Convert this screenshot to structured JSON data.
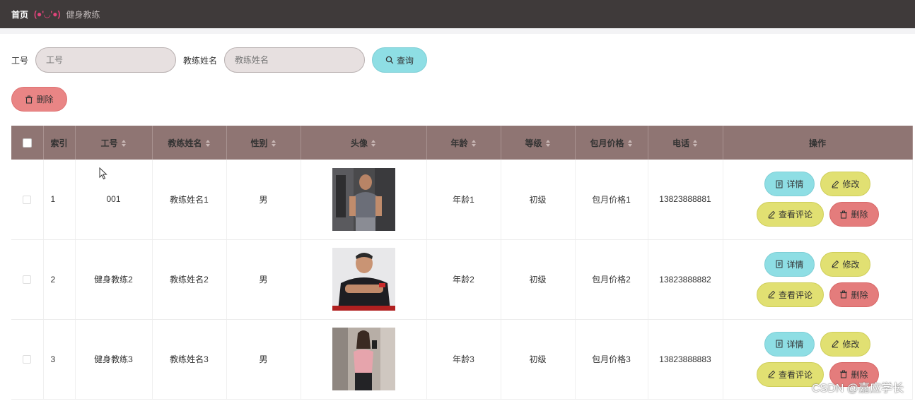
{
  "header": {
    "home": "首页",
    "emoticon": "(●'◡'●)",
    "crumb": "健身教练"
  },
  "search": {
    "id_label": "工号",
    "id_placeholder": "工号",
    "name_label": "教练姓名",
    "name_placeholder": "教练姓名",
    "query_label": "查询"
  },
  "toolbar": {
    "delete_label": "删除"
  },
  "table": {
    "columns": [
      "索引",
      "工号",
      "教练姓名",
      "性别",
      "头像",
      "年龄",
      "等级",
      "包月价格",
      "电话",
      "操作"
    ],
    "rows": [
      {
        "index": "1",
        "id": "001",
        "name": "教练姓名1",
        "gender": "男",
        "age": "年龄1",
        "level": "初级",
        "price": "包月价格1",
        "phone": "13823888881"
      },
      {
        "index": "2",
        "id": "健身教练2",
        "name": "教练姓名2",
        "gender": "男",
        "age": "年龄2",
        "level": "初级",
        "price": "包月价格2",
        "phone": "13823888882"
      },
      {
        "index": "3",
        "id": "健身教练3",
        "name": "教练姓名3",
        "gender": "男",
        "age": "年龄3",
        "level": "初级",
        "price": "包月价格3",
        "phone": "13823888883"
      }
    ],
    "actions": {
      "detail": "详情",
      "edit": "修改",
      "review": "查看评论",
      "delete": "删除"
    }
  },
  "watermark": "CSDN @嘉应学长",
  "colors": {
    "topbar": "#3f3a3a",
    "table_header": "#8f7573",
    "cyan_button": "#8edee4",
    "yellow_button": "#e1e072",
    "red_button": "#e47c7c",
    "accent_pink": "#e0447a"
  }
}
